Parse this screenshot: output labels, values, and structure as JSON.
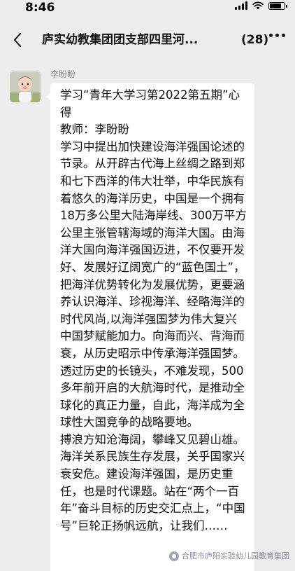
{
  "status_bar": {
    "time": "8:46"
  },
  "header": {
    "back_icon": "chevron-left-icon",
    "title": "庐实幼教集团团支部四里河...",
    "member_count": "(28)",
    "more_icon": "ellipsis-icon"
  },
  "message": {
    "sender": "李盼盼",
    "avatar_icon": "baby-photo-avatar",
    "text": "学习“青年大学习第2022第五期”心得\n教师：李盼盼\n学习中提出加快建设海洋强国论述的节录。从开辟古代海上丝绸之路到郑和七下西洋的伟大壮举，中华民族有着悠久的海洋历史，中国是一个拥有18万多公里大陆海岸线、300万平方公里主张管辖海域的海洋大国。由海洋大国向海洋强国迈进，不仅要开发好、发展好辽阔宽广的“蓝色国土”，把海洋优势转化为发展优势，更要涵养认识海洋、珍视海洋、经略海洋的时代风尚,以海洋强国梦为伟大复兴中国梦赋能加力。向海而兴、背海而衰，从历史昭示中传承海洋强国梦。透过历史的长镜头，不难发现，500多年前开启的大航海时代，是推动全球化的真正力量，自此，海洋成为全球性大国竞争的战略要地。\n搏浪方知沧海阔，攀峰又见碧山雄。海洋关系民族生存发展，关乎国家兴衰安危。建设海洋强国，是历史重任，也是时代课题。站在“两个一百年”奋斗目标的历史交汇点上，“中国号”巨轮正扬帆远航，让我们……"
  },
  "watermark": {
    "text": "合肥市庐阳实验幼儿园教育集团"
  }
}
